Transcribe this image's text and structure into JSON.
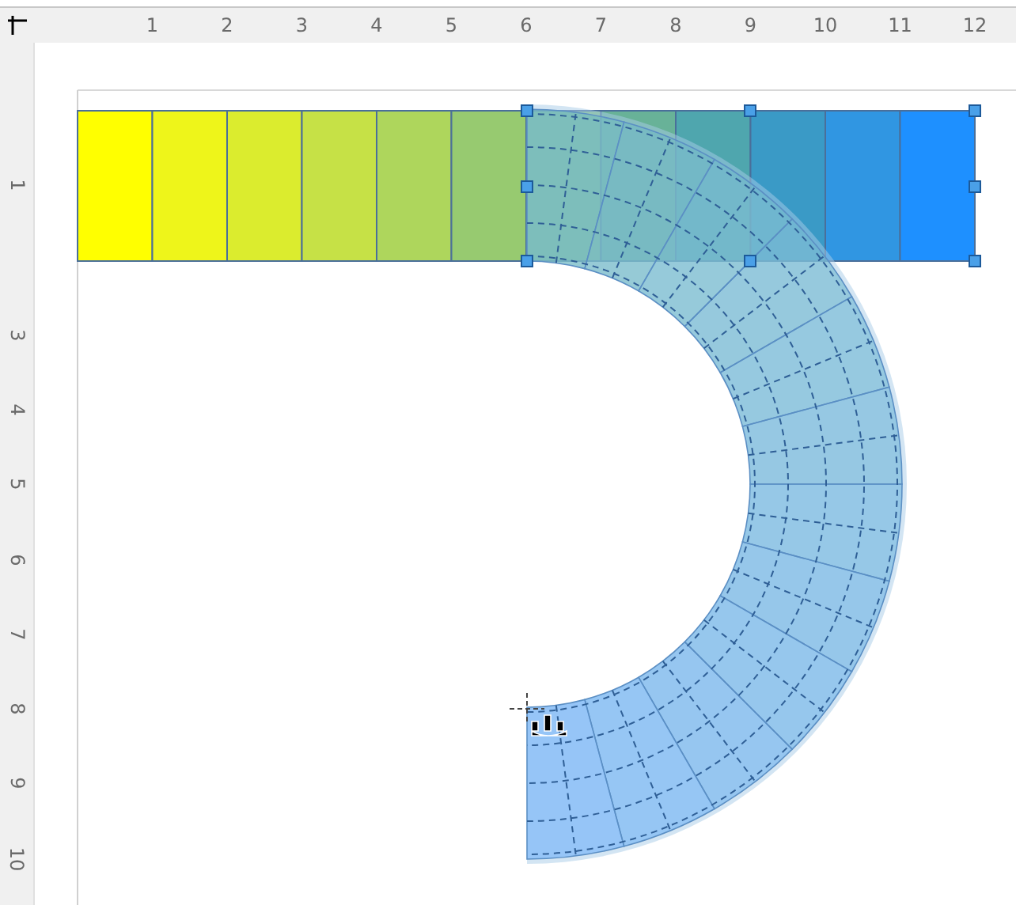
{
  "horizontal_ruler": [
    "1",
    "2",
    "3",
    "4",
    "5",
    "6",
    "7",
    "8",
    "9",
    "10",
    "11",
    "12"
  ],
  "vertical_ruler": [
    "1",
    "3",
    "4",
    "5",
    "6",
    "7",
    "8",
    "9",
    "10"
  ],
  "arc_shape": {
    "selected": true
  }
}
